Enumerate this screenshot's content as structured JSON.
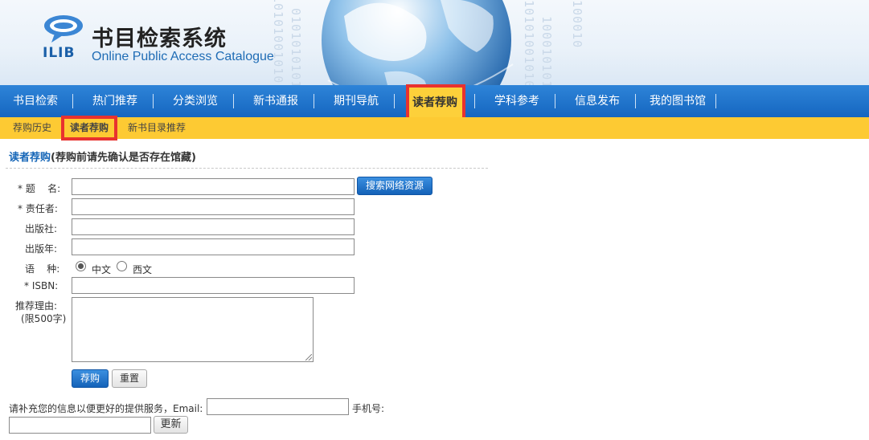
{
  "header": {
    "logo_text": "ILIB",
    "title": "书目检索系统",
    "subtitle": "Online Public Access Catalogue"
  },
  "main_nav": [
    {
      "label": "书目检索"
    },
    {
      "label": "热门推荐"
    },
    {
      "label": "分类浏览"
    },
    {
      "label": "新书通报"
    },
    {
      "label": "期刊导航"
    },
    {
      "label": "读者荐购",
      "active": true
    },
    {
      "label": "学科参考"
    },
    {
      "label": "信息发布"
    },
    {
      "label": "我的图书馆"
    }
  ],
  "sub_nav": [
    {
      "label": "荐购历史"
    },
    {
      "label": "读者荐购",
      "active": true
    },
    {
      "label": "新书目录推荐"
    }
  ],
  "form": {
    "heading_link": "读者荐购",
    "heading_note": "(荐购前请先确认是否存在馆藏)",
    "title_label": "* 题    名:",
    "author_label": "* 责任者:",
    "publisher_label": "出版社:",
    "year_label": "出版年:",
    "language_label": "语    种:",
    "language_options": [
      "中文",
      "西文"
    ],
    "language_selected": "中文",
    "isbn_label": "* ISBN:",
    "reason_label": "推荐理由:",
    "reason_limit": "(限500字)",
    "search_button": "搜索网络资源",
    "submit_button": "荐购",
    "reset_button": "重置"
  },
  "contact": {
    "prompt": "请补充您的信息以便更好的提供服务，Email:",
    "phone_label": "手机号:",
    "update_button": "更新"
  },
  "colors": {
    "nav_blue": "#1566c0",
    "sub_nav_yellow": "#fdca33",
    "highlight_red": "#e8322f",
    "link_blue": "#1767b8"
  }
}
